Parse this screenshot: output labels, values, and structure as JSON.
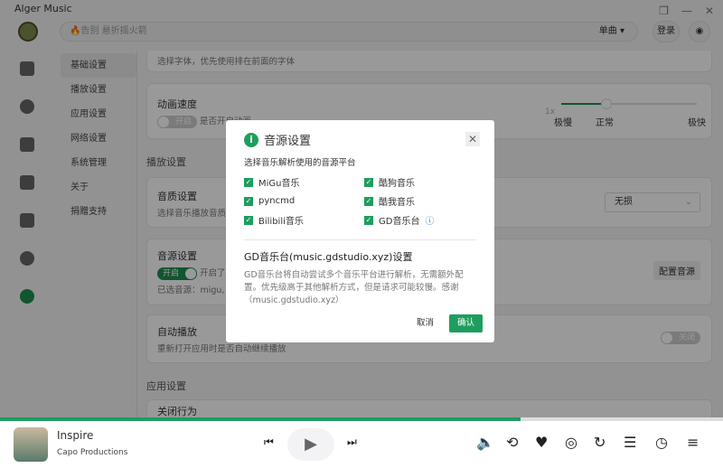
{
  "app": {
    "title": "Alger Music"
  },
  "header": {
    "search_placeholder": "🔥告别 悬折摇火箭",
    "search_type": "单曲",
    "login": "登录"
  },
  "submenu": [
    "基础设置",
    "播放设置",
    "应用设置",
    "网络设置",
    "系统管理",
    "关于",
    "捐赠支持"
  ],
  "content": {
    "font_desc": "选择字体，优先使用排在前面的字体",
    "anim_title": "动画速度",
    "anim_toggle": "开启",
    "anim_desc": "是否开启动画",
    "speed_value": "1x",
    "speed_labels": [
      "极慢",
      "正常",
      "极快"
    ],
    "speed_level": 0.33,
    "play_section": "播放设置",
    "quality_title": "音质设置",
    "quality_desc": "选择音乐播放音质",
    "quality_value": "无损",
    "source_title": "音源设置",
    "source_toggle": "开启",
    "source_desc": "开启了",
    "source_selected": "已选音源：migu, k",
    "source_button": "配置音源",
    "autoplay_title": "自动播放",
    "autoplay_desc": "重新打开应用时是否自动继续播放",
    "autoplay_toggle": "关闭",
    "app_section": "应用设置",
    "close_title": "关闭行为"
  },
  "dialog": {
    "title": "音源设置",
    "subtitle": "选择音乐解析使用的音源平台",
    "options": [
      "MiGu音乐",
      "酷狗音乐",
      "pyncmd",
      "酷我音乐",
      "Bilibili音乐",
      "GD音乐台"
    ],
    "gd_title": "GD音乐台(music.gdstudio.xyz)设置",
    "gd_desc": "GD音乐台将自动尝试多个音乐平台进行解析，无需额外配置。优先级高于其他解析方式，但是请求可能较慢。感谢（music.gdstudio.xyz）",
    "cancel": "取消",
    "confirm": "确认"
  },
  "player": {
    "song": "Inspire",
    "artist": "Capo Productions",
    "progress": 0.72
  },
  "colors": {
    "accent": "#1e9e5e"
  }
}
